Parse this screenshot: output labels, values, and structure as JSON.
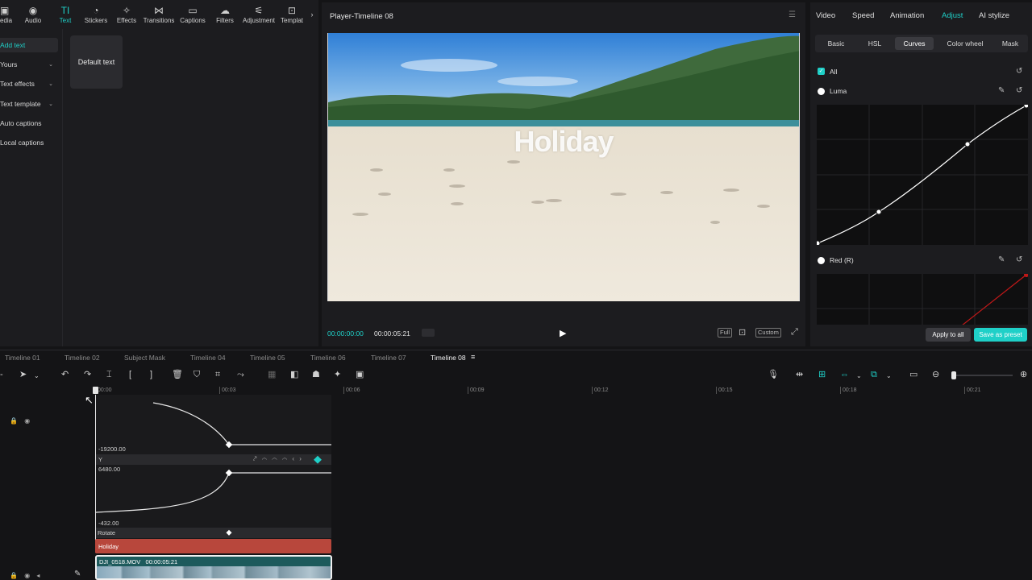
{
  "toolbar": {
    "items": [
      {
        "label": "Media",
        "display": "edia",
        "icon": "media-icon"
      },
      {
        "label": "Audio",
        "icon": "audio-icon"
      },
      {
        "label": "Text",
        "icon": "text-icon",
        "active": true
      },
      {
        "label": "Stickers",
        "icon": "stickers-icon"
      },
      {
        "label": "Effects",
        "icon": "effects-icon"
      },
      {
        "label": "Transitions",
        "icon": "transitions-icon"
      },
      {
        "label": "Captions",
        "icon": "captions-icon"
      },
      {
        "label": "Filters",
        "icon": "filters-icon"
      },
      {
        "label": "Adjustment",
        "icon": "adjustment-icon"
      },
      {
        "label": "Templat",
        "icon": "templates-icon"
      }
    ]
  },
  "left_nav": {
    "items": [
      "Add text",
      "Yours",
      "Text effects",
      "Text template",
      "Auto captions",
      "Local captions"
    ],
    "default_card": "Default text"
  },
  "player": {
    "title": "Player-Timeline 08",
    "overlay_text": "Holiday",
    "current_time": "00:00:00:00",
    "duration": "00:00:05:21",
    "full_label": "Full",
    "custom_label": "Custom"
  },
  "right_panel": {
    "tabs": [
      "Video",
      "Speed",
      "Animation",
      "Adjust",
      "AI stylize"
    ],
    "active_tab": "Adjust",
    "sub_tabs": [
      "Basic",
      "HSL",
      "Curves",
      "Color wheel",
      "Mask"
    ],
    "active_sub_tab": "Curves",
    "all_label": "All",
    "luma_label": "Luma",
    "red_label": "Red (R)",
    "apply_to_all": "Apply to all",
    "save_as_preset": "Save as preset",
    "accent": "#1fd0c8"
  },
  "timeline": {
    "tabs": [
      "Timeline 01",
      "Timeline 02",
      "Subject Mask",
      "Timeline 04",
      "Timeline 05",
      "Timeline 06",
      "Timeline 07",
      "Timeline 08"
    ],
    "active_tab": "Timeline 08",
    "ruler": [
      "00:00",
      "00:03",
      "00:06",
      "00:09",
      "00:12",
      "00:15",
      "00:18",
      "00:21"
    ],
    "graph1_value": "-19200.00",
    "graph2_label": "Y",
    "graph2_top": "6480.00",
    "graph2_bottom": "-432.00",
    "rotate_label": "Rotate",
    "text_clip": "Holiday",
    "video_clip_name": "DJI_0518.MOV",
    "video_clip_duration": "00:00:05:21"
  }
}
